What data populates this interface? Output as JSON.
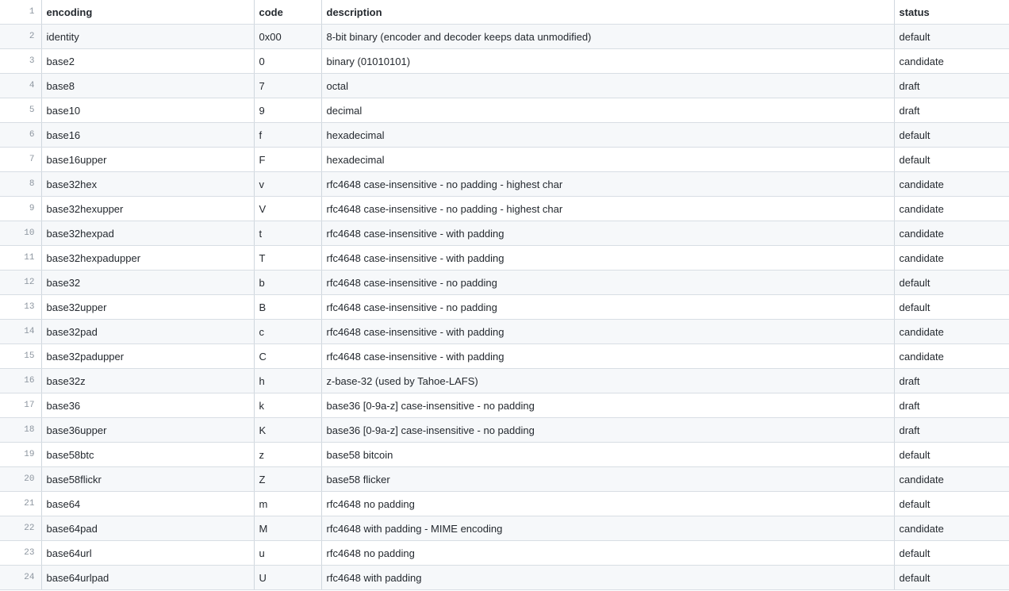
{
  "table": {
    "header": {
      "line": "1",
      "cells": [
        "encoding",
        "code",
        "description",
        "status"
      ]
    },
    "rows": [
      {
        "line": "2",
        "cells": [
          "identity",
          "0x00",
          "8-bit binary (encoder and decoder keeps data unmodified)",
          "default"
        ]
      },
      {
        "line": "3",
        "cells": [
          "base2",
          "0",
          "binary (01010101)",
          "candidate"
        ]
      },
      {
        "line": "4",
        "cells": [
          "base8",
          "7",
          "octal",
          "draft"
        ]
      },
      {
        "line": "5",
        "cells": [
          "base10",
          "9",
          "decimal",
          "draft"
        ]
      },
      {
        "line": "6",
        "cells": [
          "base16",
          "f",
          "hexadecimal",
          "default"
        ]
      },
      {
        "line": "7",
        "cells": [
          "base16upper",
          "F",
          "hexadecimal",
          "default"
        ]
      },
      {
        "line": "8",
        "cells": [
          "base32hex",
          "v",
          "rfc4648 case-insensitive - no padding - highest char",
          "candidate"
        ]
      },
      {
        "line": "9",
        "cells": [
          "base32hexupper",
          "V",
          "rfc4648 case-insensitive - no padding - highest char",
          "candidate"
        ]
      },
      {
        "line": "10",
        "cells": [
          "base32hexpad",
          "t",
          "rfc4648 case-insensitive - with padding",
          "candidate"
        ]
      },
      {
        "line": "11",
        "cells": [
          "base32hexpadupper",
          "T",
          "rfc4648 case-insensitive - with padding",
          "candidate"
        ]
      },
      {
        "line": "12",
        "cells": [
          "base32",
          "b",
          "rfc4648 case-insensitive - no padding",
          "default"
        ]
      },
      {
        "line": "13",
        "cells": [
          "base32upper",
          "B",
          "rfc4648 case-insensitive - no padding",
          "default"
        ]
      },
      {
        "line": "14",
        "cells": [
          "base32pad",
          "c",
          "rfc4648 case-insensitive - with padding",
          "candidate"
        ]
      },
      {
        "line": "15",
        "cells": [
          "base32padupper",
          "C",
          "rfc4648 case-insensitive - with padding",
          "candidate"
        ]
      },
      {
        "line": "16",
        "cells": [
          "base32z",
          "h",
          "z-base-32 (used by Tahoe-LAFS)",
          "draft"
        ]
      },
      {
        "line": "17",
        "cells": [
          "base36",
          "k",
          "base36 [0-9a-z] case-insensitive - no padding",
          "draft"
        ]
      },
      {
        "line": "18",
        "cells": [
          "base36upper",
          "K",
          "base36 [0-9a-z] case-insensitive - no padding",
          "draft"
        ]
      },
      {
        "line": "19",
        "cells": [
          "base58btc",
          "z",
          "base58 bitcoin",
          "default"
        ]
      },
      {
        "line": "20",
        "cells": [
          "base58flickr",
          "Z",
          "base58 flicker",
          "candidate"
        ]
      },
      {
        "line": "21",
        "cells": [
          "base64",
          "m",
          "rfc4648 no padding",
          "default"
        ]
      },
      {
        "line": "22",
        "cells": [
          "base64pad",
          "M",
          "rfc4648 with padding - MIME encoding",
          "candidate"
        ]
      },
      {
        "line": "23",
        "cells": [
          "base64url",
          "u",
          "rfc4648 no padding",
          "default"
        ]
      },
      {
        "line": "24",
        "cells": [
          "base64urlpad",
          "U",
          "rfc4648 with padding",
          "default"
        ]
      }
    ]
  }
}
